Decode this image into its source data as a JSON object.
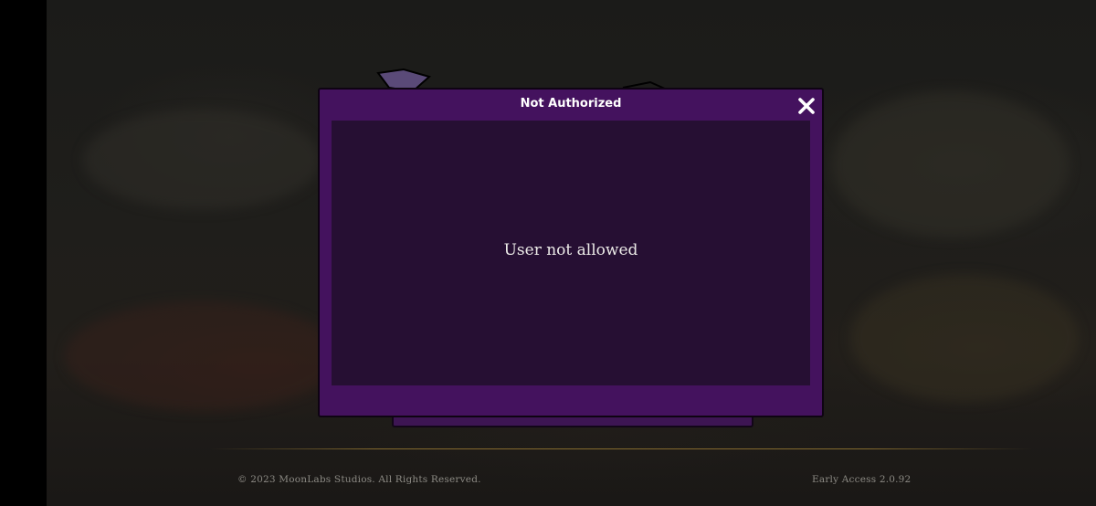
{
  "dialog": {
    "title": "Not Authorized",
    "message": "User not allowed",
    "close_icon": "close-icon"
  },
  "footer": {
    "copyright": "© 2023 MoonLabs Studios. All Rights Reserved.",
    "version": "Early Access 2.0.92"
  },
  "colors": {
    "dialog_frame": "#44125e",
    "dialog_body": "#260f33",
    "footer_text": "#8c8a84",
    "gold_divider": "#96783a"
  }
}
